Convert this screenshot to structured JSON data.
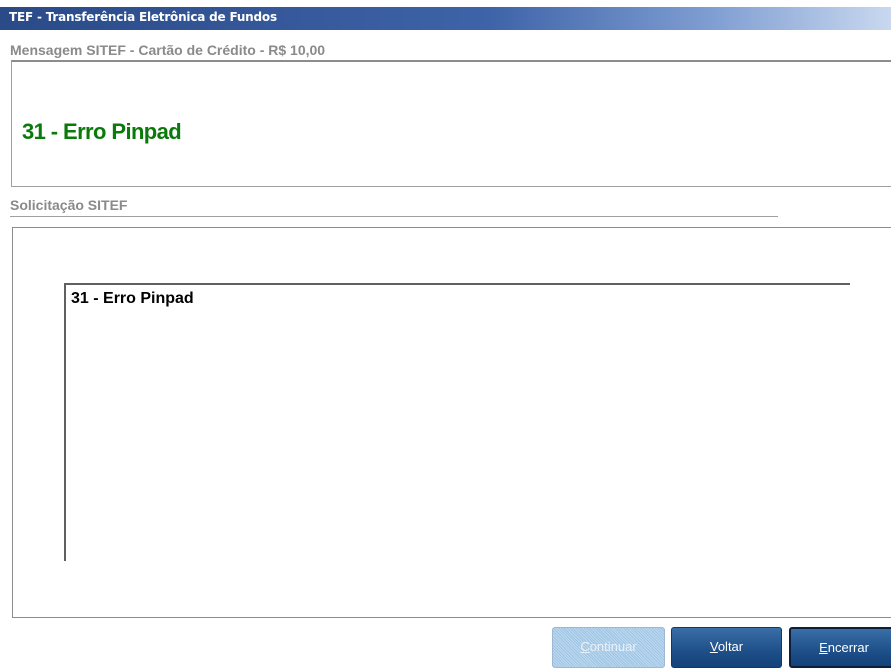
{
  "window": {
    "title": "TEF - Transferência Eletrônica de Fundos"
  },
  "message_section": {
    "label": "Mensagem SITEF - Cartão de Crédito  - R$ 10,00",
    "message": "31 - Erro Pinpad",
    "message_color": "#0a7a0a"
  },
  "request_section": {
    "label": "Solicitação SITEF",
    "message": "31 - Erro Pinpad"
  },
  "buttons": {
    "continuar": {
      "accel": "C",
      "rest": "ontinuar",
      "enabled": false
    },
    "voltar": {
      "accel": "V",
      "rest": "oltar",
      "enabled": true
    },
    "encerrar": {
      "accel": "E",
      "rest": "ncerrar",
      "enabled": true,
      "focused": true
    }
  },
  "colors": {
    "titlebar": "#3e63a8",
    "button": "#1e4f88",
    "button_disabled": "#9cc4e4",
    "label": "#8a8a8a"
  }
}
